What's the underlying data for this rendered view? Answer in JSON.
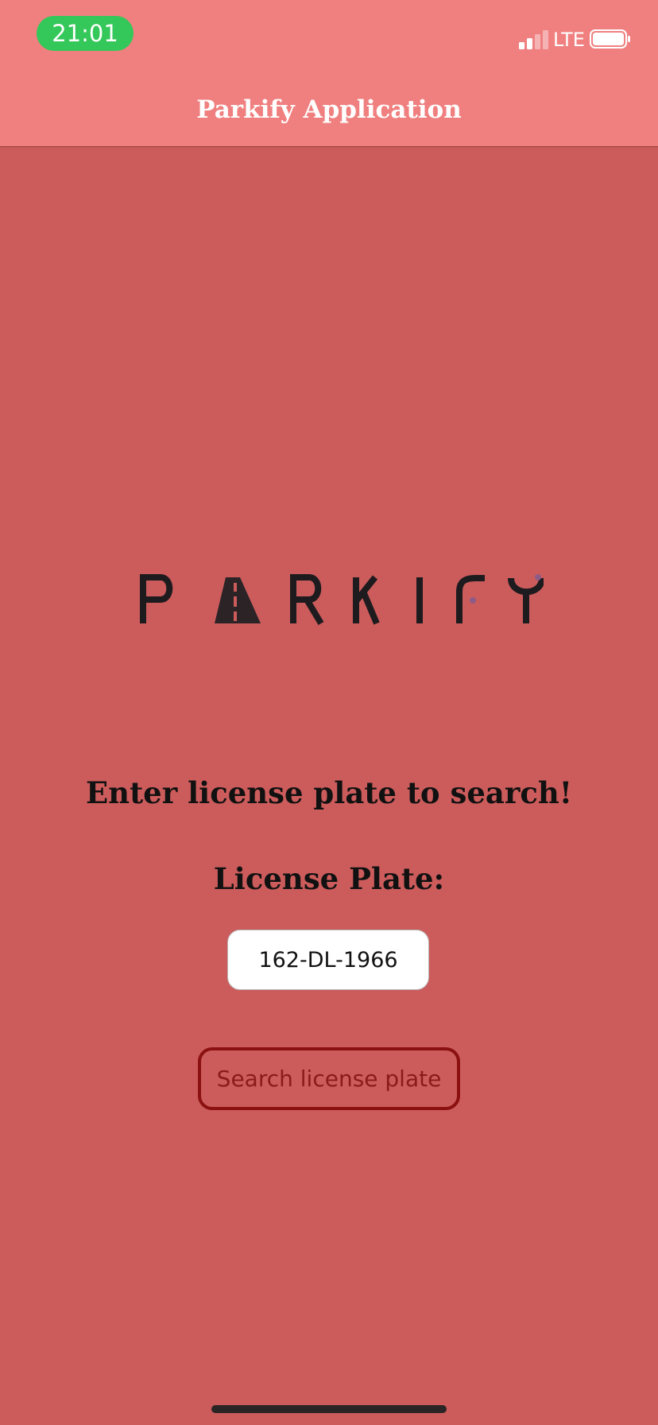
{
  "status_bar": {
    "time": "21:01",
    "network": "LTE",
    "icons": [
      "signal-icon",
      "battery-icon"
    ]
  },
  "nav": {
    "title": "Parkify Application"
  },
  "logo": {
    "text": "PARKIFY"
  },
  "form": {
    "prompt": "Enter license plate to search!",
    "plate_label": "License Plate:",
    "plate_value": "162-DL-1966",
    "search_button_label": "Search license plate"
  },
  "colors": {
    "header": "#f08080",
    "background": "#cb5c5b",
    "status_pill": "#34c759",
    "button_border": "#8b1010",
    "logo_ink": "#1e1b1f"
  }
}
